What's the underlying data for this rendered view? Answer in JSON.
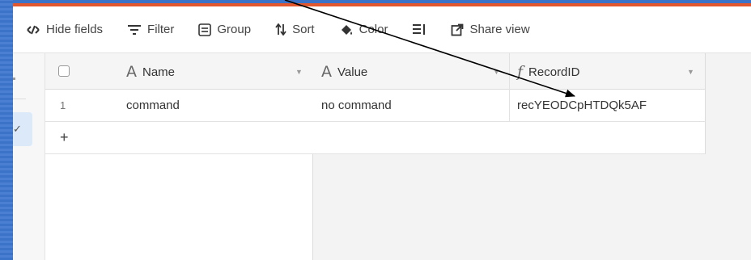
{
  "toolbar": {
    "hide_fields": "Hide fields",
    "filter": "Filter",
    "group": "Group",
    "sort": "Sort",
    "color": "Color",
    "share_view": "Share view"
  },
  "table": {
    "columns": [
      {
        "label": "Name",
        "type_icon": "text-type-icon"
      },
      {
        "label": "Value",
        "type_icon": "text-type-icon"
      },
      {
        "label": "RecordID",
        "type_icon": "formula-type-icon"
      }
    ],
    "rows": [
      {
        "number": "1",
        "name": "command",
        "value": "no command",
        "record_id": "recYEODCpHTDQk5AF"
      }
    ],
    "add_row_symbol": "+"
  },
  "colors": {
    "accent_bar": "#e3572e",
    "background_edge": "#3b73c9",
    "annotation_arrow": "#000000"
  }
}
